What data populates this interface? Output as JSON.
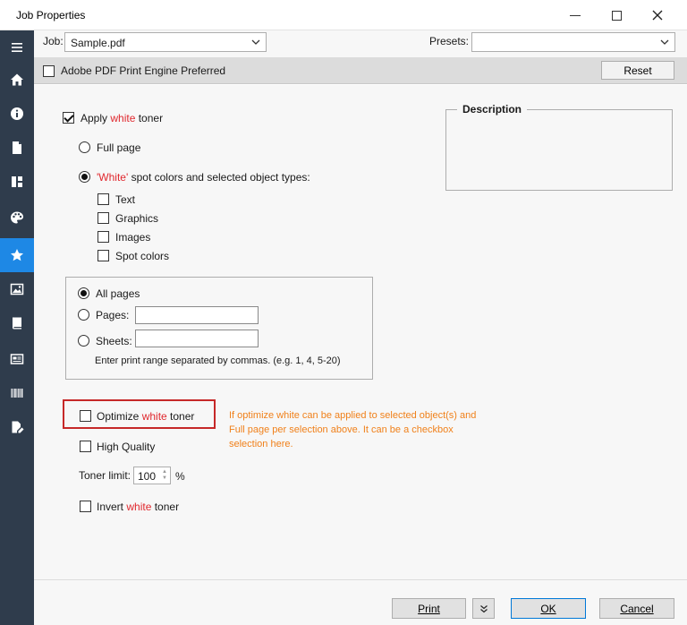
{
  "window": {
    "title": "Job Properties"
  },
  "sidebar": {
    "items": [
      {
        "icon": "menu-icon"
      },
      {
        "icon": "home-icon"
      },
      {
        "icon": "info-icon"
      },
      {
        "icon": "document-icon"
      },
      {
        "icon": "layout-icon"
      },
      {
        "icon": "palette-icon"
      },
      {
        "icon": "star-icon",
        "active": true
      },
      {
        "icon": "image-icon"
      },
      {
        "icon": "book-icon"
      },
      {
        "icon": "card-icon"
      },
      {
        "icon": "barcode-icon"
      },
      {
        "icon": "doc-edit-icon"
      }
    ],
    "active_color": "#1e88e5",
    "background": "#2f3c4c"
  },
  "job_row": {
    "job_label": "Job:",
    "job_value": "Sample.pdf",
    "presets_label": "Presets:",
    "presets_value": ""
  },
  "option_bar": {
    "engine_label": "Adobe PDF Print Engine Preferred",
    "engine_checked": false,
    "reset_label": "Reset"
  },
  "white_toner": {
    "apply": {
      "pre": "Apply ",
      "red": "white",
      "post": " toner",
      "checked": true
    },
    "full_page": {
      "label": "Full page",
      "selected": false
    },
    "spot_option": {
      "red": "'White'",
      "post": " spot colors and selected object types:",
      "selected": true
    },
    "object_types": [
      {
        "label": "Text",
        "checked": false
      },
      {
        "label": "Graphics",
        "checked": false
      },
      {
        "label": "Images",
        "checked": false
      },
      {
        "label": "Spot colors",
        "checked": false
      }
    ]
  },
  "page_range": {
    "all_pages": {
      "label": "All pages",
      "selected": true
    },
    "pages": {
      "label": "Pages:",
      "selected": false,
      "value": ""
    },
    "sheets": {
      "label": "Sheets:",
      "selected": false,
      "value": ""
    },
    "hint": "Enter print range separated by commas. (e.g. 1, 4, 5-20)"
  },
  "description": {
    "legend": "Description"
  },
  "optimize": {
    "pre": "Optimize ",
    "red": "white",
    "post": " toner",
    "checked": false
  },
  "annotation": {
    "line1": "If optimize white can be applied to selected object(s) and",
    "line2": "Full page per selection above. It can be a checkbox",
    "line3": "selection here."
  },
  "high_quality": {
    "label": "High Quality",
    "checked": false
  },
  "toner_limit": {
    "label": "Toner limit:",
    "value": "100",
    "unit": "%"
  },
  "invert": {
    "pre": "Invert ",
    "red": "white",
    "post": " toner",
    "checked": false
  },
  "footer": {
    "print_label": "Print",
    "more_label": "more-options",
    "ok_label": "OK",
    "cancel_label": "Cancel"
  }
}
